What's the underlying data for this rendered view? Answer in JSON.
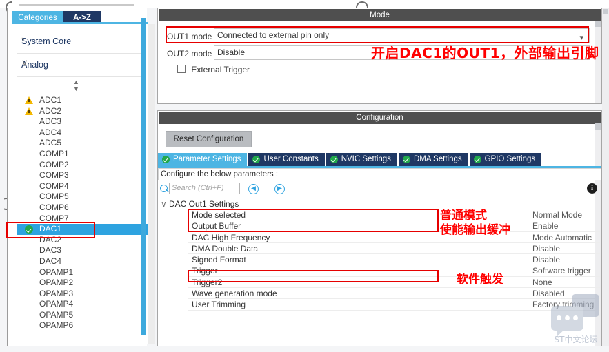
{
  "sidebar": {
    "tabs": [
      {
        "label": "Categories",
        "active": true
      },
      {
        "label": "A->Z",
        "active": false
      }
    ],
    "groups": [
      {
        "label": "System Core",
        "chevron": "›",
        "expanded": false
      },
      {
        "label": "Analog",
        "chevron": "∨",
        "expanded": true
      }
    ],
    "spinner_icon": "up-down-spinner-icon",
    "peripherals": [
      {
        "label": "ADC1",
        "icon": "warning-icon",
        "selected": false
      },
      {
        "label": "ADC2",
        "icon": "warning-icon",
        "selected": false
      },
      {
        "label": "ADC3",
        "icon": "none",
        "selected": false
      },
      {
        "label": "ADC4",
        "icon": "none",
        "selected": false
      },
      {
        "label": "ADC5",
        "icon": "none",
        "selected": false
      },
      {
        "label": "COMP1",
        "icon": "none",
        "selected": false
      },
      {
        "label": "COMP2",
        "icon": "none",
        "selected": false
      },
      {
        "label": "COMP3",
        "icon": "none",
        "selected": false
      },
      {
        "label": "COMP4",
        "icon": "none",
        "selected": false
      },
      {
        "label": "COMP5",
        "icon": "none",
        "selected": false
      },
      {
        "label": "COMP6",
        "icon": "none",
        "selected": false
      },
      {
        "label": "COMP7",
        "icon": "none",
        "selected": false
      },
      {
        "label": "DAC1",
        "icon": "check-ok-icon",
        "selected": true
      },
      {
        "label": "DAC2",
        "icon": "none",
        "selected": false
      },
      {
        "label": "DAC3",
        "icon": "none",
        "selected": false
      },
      {
        "label": "DAC4",
        "icon": "none",
        "selected": false
      },
      {
        "label": "OPAMP1",
        "icon": "none",
        "selected": false
      },
      {
        "label": "OPAMP2",
        "icon": "none",
        "selected": false
      },
      {
        "label": "OPAMP3",
        "icon": "none",
        "selected": false
      },
      {
        "label": "OPAMP4",
        "icon": "none",
        "selected": false
      },
      {
        "label": "OPAMP5",
        "icon": "none",
        "selected": false
      },
      {
        "label": "OPAMP6",
        "icon": "none",
        "selected": false
      }
    ]
  },
  "mode_panel": {
    "title": "Mode",
    "out1_label": "OUT1 mode",
    "out1_value": "Connected to external pin only",
    "out2_label": "OUT2 mode",
    "out2_value": "Disable",
    "external_trigger_label": "External Trigger",
    "external_trigger_checked": false,
    "dropdown_icon": "chevron-down-icon"
  },
  "config_panel": {
    "title": "Configuration",
    "reset_button": "Reset Configuration",
    "tabs": [
      {
        "label": "Parameter Settings",
        "active": true
      },
      {
        "label": "User Constants",
        "active": false
      },
      {
        "label": "NVIC Settings",
        "active": false
      },
      {
        "label": "DMA Settings",
        "active": false
      },
      {
        "label": "GPIO Settings",
        "active": false
      }
    ],
    "instruction": "Configure the below parameters :",
    "search_placeholder": "Search (Ctrl+F)",
    "search_value": "",
    "nav_back_icon": "chevron-left-circle-icon",
    "nav_forward_icon": "chevron-right-circle-icon",
    "info_icon": "info-icon",
    "group_label": "DAC Out1 Settings",
    "group_chevron": "∨",
    "parameters": [
      {
        "name": "Mode selected",
        "value": "Normal Mode"
      },
      {
        "name": "Output Buffer",
        "value": "Enable"
      },
      {
        "name": "DAC High Frequency",
        "value": "Mode Automatic"
      },
      {
        "name": "DMA Double Data",
        "value": "Disable"
      },
      {
        "name": "Signed Format",
        "value": "Disable"
      },
      {
        "name": "Trigger",
        "value": "Software trigger"
      },
      {
        "name": "Trigger2",
        "value": "None"
      },
      {
        "name": "Wave generation mode",
        "value": "Disabled"
      },
      {
        "name": "User Trimming",
        "value": "Factory trimming"
      }
    ]
  },
  "annotations": {
    "color": "#ff0000",
    "top_note": "开启DAC1的OUT1，外部输出引脚",
    "mode_note_line1": "普通模式",
    "mode_note_line2": "使能输出缓冲",
    "trigger_note": "软件触发"
  },
  "watermark": {
    "text": "ST中文论坛",
    "icon": "chat-bubbles-icon"
  },
  "colors": {
    "accent_blue": "#4db5e3",
    "tab_navy": "#1f3864",
    "selected_row": "#2ea3e0",
    "panel_header": "#4f4f4f",
    "ok_green": "#21a84b",
    "warn_yellow": "#f3b700",
    "annotation_red": "#ff0000"
  }
}
